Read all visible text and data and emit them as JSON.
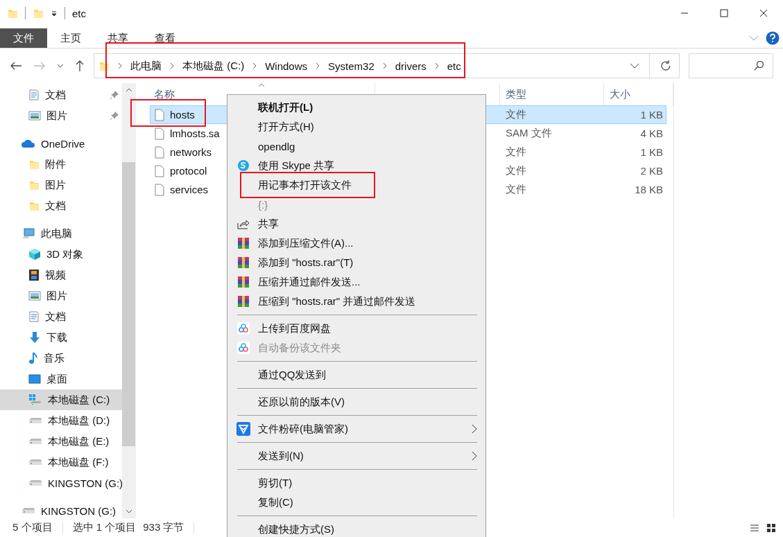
{
  "window": {
    "title": "etc"
  },
  "ribbon_tabs": [
    {
      "label": "文件",
      "selected": true
    },
    {
      "label": "主页",
      "selected": false
    },
    {
      "label": "共享",
      "selected": false
    },
    {
      "label": "查看",
      "selected": false
    }
  ],
  "address": {
    "crumbs": [
      "此电脑",
      "本地磁盘 (C:)",
      "Windows",
      "System32",
      "drivers",
      "etc"
    ],
    "annotated": true
  },
  "sidebar": {
    "quick_access": [
      {
        "label": "文档",
        "kind": "docs",
        "pinned": true,
        "selected": false
      },
      {
        "label": "图片",
        "kind": "pictures",
        "pinned": true,
        "selected": false
      }
    ],
    "items": [
      {
        "label": "OneDrive",
        "kind": "cloud",
        "selected": false,
        "children": [
          {
            "label": "附件",
            "kind": "folder",
            "selected": false
          },
          {
            "label": "图片",
            "kind": "folder",
            "selected": false
          },
          {
            "label": "文档",
            "kind": "folder",
            "selected": false
          }
        ]
      },
      {
        "label": "此电脑",
        "kind": "pc",
        "selected": false,
        "children": [
          {
            "label": "3D 对象",
            "kind": "cube",
            "selected": false
          },
          {
            "label": "视频",
            "kind": "video",
            "selected": false
          },
          {
            "label": "图片",
            "kind": "pictures",
            "selected": false
          },
          {
            "label": "文档",
            "kind": "docs",
            "selected": false
          },
          {
            "label": "下载",
            "kind": "download",
            "selected": false
          },
          {
            "label": "音乐",
            "kind": "music",
            "selected": false
          },
          {
            "label": "桌面",
            "kind": "desktop",
            "selected": false
          },
          {
            "label": "本地磁盘 (C:)",
            "kind": "windrive",
            "selected": true
          },
          {
            "label": "本地磁盘 (D:)",
            "kind": "drive",
            "selected": false
          },
          {
            "label": "本地磁盘 (E:)",
            "kind": "drive",
            "selected": false
          },
          {
            "label": "本地磁盘 (F:)",
            "kind": "drive",
            "selected": false
          },
          {
            "label": "KINGSTON (G:)",
            "kind": "drive",
            "selected": false
          }
        ]
      },
      {
        "label": "KINGSTON (G:)",
        "kind": "drive",
        "selected": false
      }
    ]
  },
  "file_list": {
    "columns": [
      {
        "label": "名称",
        "sorted": true
      },
      {
        "label": "类型",
        "sorted": false
      },
      {
        "label": "大小",
        "sorted": false
      }
    ],
    "rows": [
      {
        "name": "hosts",
        "type": "文件",
        "size": "1 KB",
        "selected": true,
        "annotated": true
      },
      {
        "name": "lmhosts.sa",
        "type": "SAM 文件",
        "size": "4 KB",
        "selected": false,
        "annotated": false
      },
      {
        "name": "networks",
        "type": "文件",
        "size": "1 KB",
        "selected": false,
        "annotated": false
      },
      {
        "name": "protocol",
        "type": "文件",
        "size": "2 KB",
        "selected": false,
        "annotated": false
      },
      {
        "name": "services",
        "type": "文件",
        "size": "18 KB",
        "selected": false,
        "annotated": false
      }
    ]
  },
  "context_menu": {
    "items": [
      {
        "kind": "plain",
        "label": "联机打开(L)",
        "default": true,
        "disabled": false,
        "submenu": false,
        "annotated": false
      },
      {
        "kind": "plain",
        "label": "打开方式(H)",
        "default": false,
        "disabled": false,
        "submenu": false,
        "annotated": false
      },
      {
        "kind": "plain",
        "label": "opendlg",
        "default": false,
        "disabled": false,
        "submenu": false,
        "annotated": false
      },
      {
        "kind": "skype",
        "label": "使用 Skype 共享",
        "default": false,
        "disabled": false,
        "submenu": false,
        "annotated": false
      },
      {
        "kind": "plain",
        "label": "用记事本打开该文件",
        "default": false,
        "disabled": false,
        "submenu": false,
        "annotated": true
      },
      {
        "kind": "plain",
        "label": "{:}",
        "default": false,
        "disabled": true,
        "submenu": false,
        "annotated": false
      },
      {
        "kind": "share",
        "label": "共享",
        "default": false,
        "disabled": false,
        "submenu": false,
        "annotated": false
      },
      {
        "kind": "archive",
        "label": "添加到压缩文件(A)...",
        "default": false,
        "disabled": false,
        "submenu": false,
        "annotated": false
      },
      {
        "kind": "archive",
        "label": "添加到 \"hosts.rar\"(T)",
        "default": false,
        "disabled": false,
        "submenu": false,
        "annotated": false
      },
      {
        "kind": "archive",
        "label": "压缩并通过邮件发送...",
        "default": false,
        "disabled": false,
        "submenu": false,
        "annotated": false
      },
      {
        "kind": "archive",
        "label": "压缩到 \"hosts.rar\" 并通过邮件发送",
        "default": false,
        "disabled": false,
        "submenu": false,
        "annotated": false
      },
      {
        "kind": "separator"
      },
      {
        "kind": "cloud",
        "label": "上传到百度网盘",
        "default": false,
        "disabled": false,
        "submenu": false,
        "annotated": false
      },
      {
        "kind": "cloud",
        "label": "自动备份该文件夹",
        "default": false,
        "disabled": true,
        "submenu": false,
        "annotated": false
      },
      {
        "kind": "separator"
      },
      {
        "kind": "plain",
        "label": "通过QQ发送到",
        "default": false,
        "disabled": false,
        "submenu": false,
        "annotated": false
      },
      {
        "kind": "separator"
      },
      {
        "kind": "plain",
        "label": "还原以前的版本(V)",
        "default": false,
        "disabled": false,
        "submenu": false,
        "annotated": false
      },
      {
        "kind": "separator"
      },
      {
        "kind": "shield",
        "label": "文件粉碎(电脑管家)",
        "default": false,
        "disabled": false,
        "submenu": true,
        "annotated": false
      },
      {
        "kind": "separator"
      },
      {
        "kind": "plain",
        "label": "发送到(N)",
        "default": false,
        "disabled": false,
        "submenu": true,
        "annotated": false
      },
      {
        "kind": "separator"
      },
      {
        "kind": "plain",
        "label": "剪切(T)",
        "default": false,
        "disabled": false,
        "submenu": false,
        "annotated": false
      },
      {
        "kind": "plain",
        "label": "复制(C)",
        "default": false,
        "disabled": false,
        "submenu": false,
        "annotated": false
      },
      {
        "kind": "separator"
      },
      {
        "kind": "plain",
        "label": "创建快捷方式(S)",
        "default": false,
        "disabled": false,
        "submenu": false,
        "annotated": false
      }
    ]
  },
  "status_bar": {
    "count": "5 个项目",
    "selection": "选中 1 个项目",
    "size": "933 字节"
  }
}
